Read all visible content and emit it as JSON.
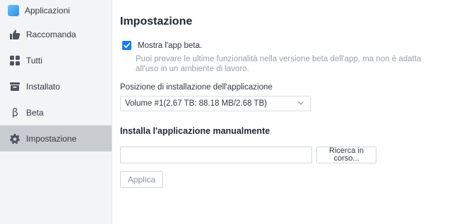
{
  "sidebar": {
    "app_title": "Applicazioni",
    "items": [
      {
        "label": "Raccomanda",
        "icon": "thumbs-up-icon",
        "active": false
      },
      {
        "label": "Tutti",
        "icon": "grid-icon",
        "active": false
      },
      {
        "label": "Installato",
        "icon": "installed-box-icon",
        "active": false
      },
      {
        "label": "Beta",
        "icon": "beta-icon",
        "active": false
      },
      {
        "label": "Impostazione",
        "icon": "gear-icon",
        "active": true
      }
    ]
  },
  "main": {
    "title": "Impostazione",
    "beta": {
      "label": "Mostra l'app beta.",
      "checked": true,
      "hint": "Puoi provare le ultime funzionalità nella versione beta dell'app, ma non è adatta all'uso in un ambiente di lavoro."
    },
    "install_location": {
      "label": "Posizione di installazione dell'applicazione",
      "selected": "Volume #1(2.67 TB: 88.18 MB/2.68 TB)"
    },
    "manual_install": {
      "title": "Installa l'applicazione manualmente",
      "input_value": "",
      "browse_label": "Ricerca in corso...",
      "apply_label": "Applica"
    }
  },
  "colors": {
    "accent": "#1d7de5",
    "sidebar_bg": "#f3f4f5",
    "active_item_bg": "#c8ccd0"
  }
}
